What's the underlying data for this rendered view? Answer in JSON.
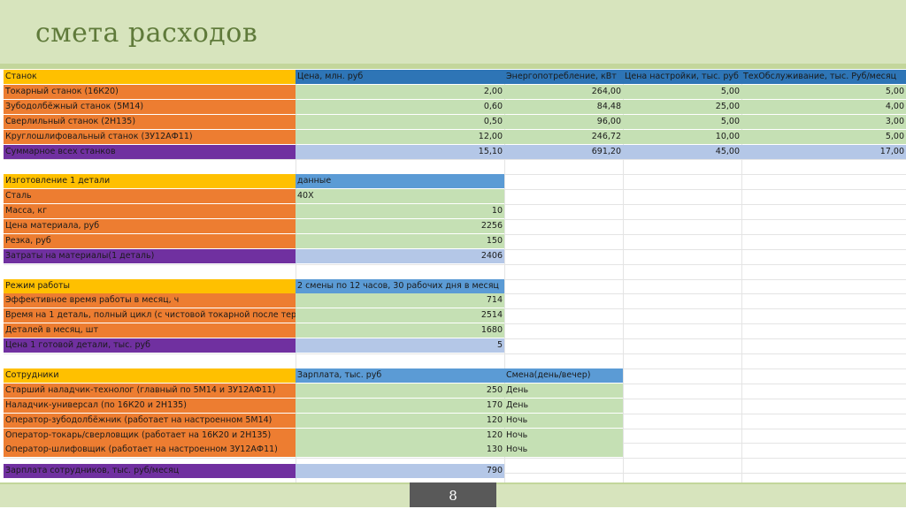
{
  "slide": {
    "title": "смета расходов",
    "page_number": "8"
  },
  "machines": {
    "header": [
      "Станок",
      "Цена, млн. руб",
      "Энергопотребление, кВт",
      "Цена настройки, тыс. руб",
      "ТехОбслуживание, тыс. Руб/месяц"
    ],
    "rows": [
      [
        "Токарный станок (16К20)",
        "2,00",
        "264,00",
        "5,00",
        "5,00"
      ],
      [
        "Зубодолбёжный станок (5М14)",
        "0,60",
        "84,48",
        "25,00",
        "4,00"
      ],
      [
        "Сверлильный станок (2Н135)",
        "0,50",
        "96,00",
        "5,00",
        "3,00"
      ],
      [
        "Круглошлифовальный станок (3У12АФ11)",
        "12,00",
        "246,72",
        "10,00",
        "5,00"
      ]
    ],
    "total": [
      "Суммарное всех станков",
      "15,10",
      "691,20",
      "45,00",
      "17,00"
    ]
  },
  "part": {
    "header": [
      "Изготовление 1 детали",
      "данные"
    ],
    "rows": [
      [
        "Сталь",
        "40Х"
      ],
      [
        "Масса, кг",
        "10"
      ],
      [
        "Цена материала, руб",
        "2256"
      ],
      [
        "Резка, руб",
        "150"
      ]
    ],
    "total": [
      "Затраты на материалы(1 деталь)",
      "2406"
    ]
  },
  "mode": {
    "header": [
      "Режим работы",
      "2 смены по 12 часов, 30 рабочих дня в месяц"
    ],
    "rows": [
      [
        "Эффективное время работы в месяц, ч",
        "714"
      ],
      [
        "Время на 1 деталь, полный цикл (с чистовой токарной после тер",
        "2514"
      ],
      [
        "Деталей в месяц, шт",
        "1680"
      ]
    ],
    "total": [
      "Цена 1 готовой детали, тыс. руб",
      "5"
    ]
  },
  "staff": {
    "header": [
      "Сотрудники",
      "Зарплата, тыс. руб",
      "Смена(день/вечер)"
    ],
    "rows": [
      [
        "Старший наладчик-технолог (главный по 5М14 и 3У12АФ11)",
        "250",
        "День"
      ],
      [
        "Наладчик-универсал (по 16К20 и 2Н135)",
        "170",
        "День"
      ],
      [
        "Оператор-зубодолбёжник (работает на настроенном 5М14)",
        "120",
        "Ночь"
      ],
      [
        " Оператор-токарь/сверловщик (работает на 16К20 и 2Н135)",
        "120",
        "Ночь"
      ],
      [
        "Оператор-шлифовщик (работает на настроенном 3У12АФ11)",
        "130",
        "Ночь"
      ]
    ],
    "total": [
      "Зарплата сотрудников, тыс. руб/месяц",
      "790"
    ]
  },
  "colors": {
    "header_yellow": "#ffc000",
    "label_orange": "#ed7d31",
    "total_purple": "#7030a0",
    "header_blue": "#2e75b6",
    "value_green": "#c5e0b4",
    "total_blue": "#b4c7e7",
    "slide_green": "#d7e4bd"
  }
}
